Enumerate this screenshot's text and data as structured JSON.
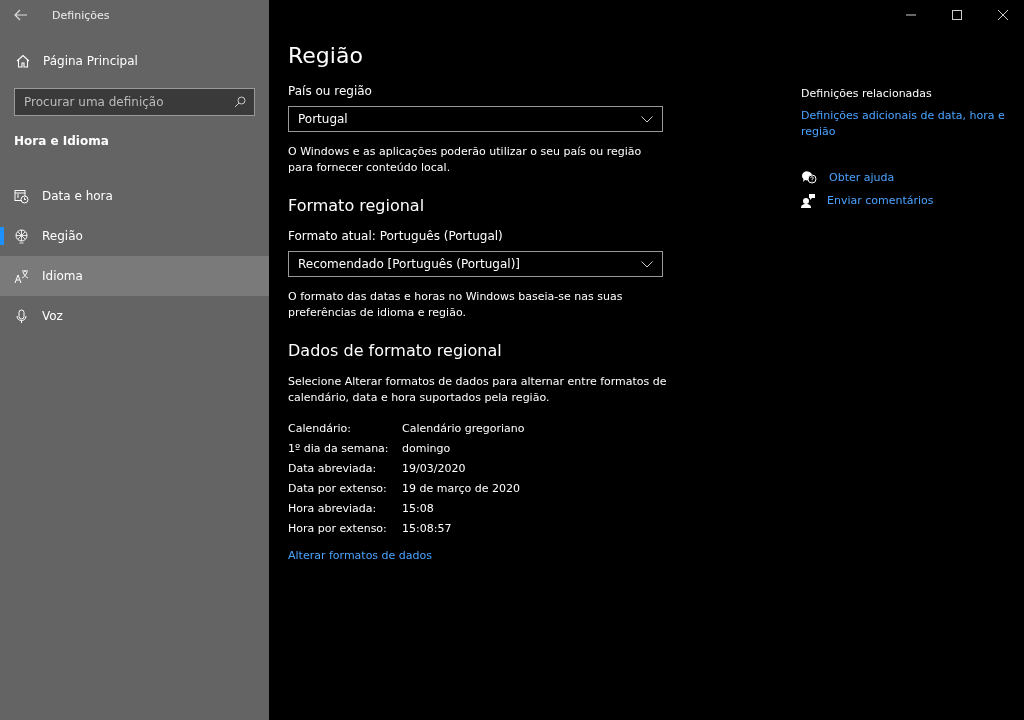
{
  "window": {
    "title": "Definições"
  },
  "sidebar": {
    "home": "Página Principal",
    "search": {
      "placeholder": "Procurar uma definição"
    },
    "section": "Hora e Idioma",
    "items": [
      {
        "label": "Data e hora",
        "kind": "calendar",
        "selected": false,
        "hovered": false
      },
      {
        "label": "Região",
        "kind": "globe",
        "selected": true,
        "hovered": false
      },
      {
        "label": "Idioma",
        "kind": "language",
        "selected": false,
        "hovered": true
      },
      {
        "label": "Voz",
        "kind": "microphone",
        "selected": false,
        "hovered": false
      }
    ]
  },
  "page": {
    "title": "Região",
    "country": {
      "label": "País ou região",
      "value": "Portugal",
      "help": "O Windows e as aplicações poderão utilizar o seu país ou região para fornecer conteúdo local."
    },
    "format": {
      "heading": "Formato regional",
      "label": "Formato atual: Português (Portugal)",
      "value": "Recomendado [Português (Portugal)]",
      "help": "O formato das datas e horas no Windows baseia-se nas suas preferências de idioma e região."
    },
    "data": {
      "heading": "Dados de formato regional",
      "help": "Selecione Alterar formatos de dados para alternar entre formatos de calendário, data e hora suportados pela região.",
      "rows": [
        {
          "label": "Calendário:",
          "value": "Calendário gregoriano"
        },
        {
          "label": "1º dia da semana:",
          "value": "domingo"
        },
        {
          "label": "Data abreviada:",
          "value": "19/03/2020"
        },
        {
          "label": "Data por extenso:",
          "value": "19 de março de 2020"
        },
        {
          "label": "Hora abreviada:",
          "value": "15:08"
        },
        {
          "label": "Hora por extenso:",
          "value": "15:08:57"
        }
      ],
      "link": "Alterar formatos de dados"
    }
  },
  "related": {
    "heading": "Definições relacionadas",
    "link": "Definições adicionais de data, hora e região",
    "support": [
      {
        "label": "Obter ajuda",
        "kind": "help"
      },
      {
        "label": "Enviar comentários",
        "kind": "feedback"
      }
    ]
  }
}
